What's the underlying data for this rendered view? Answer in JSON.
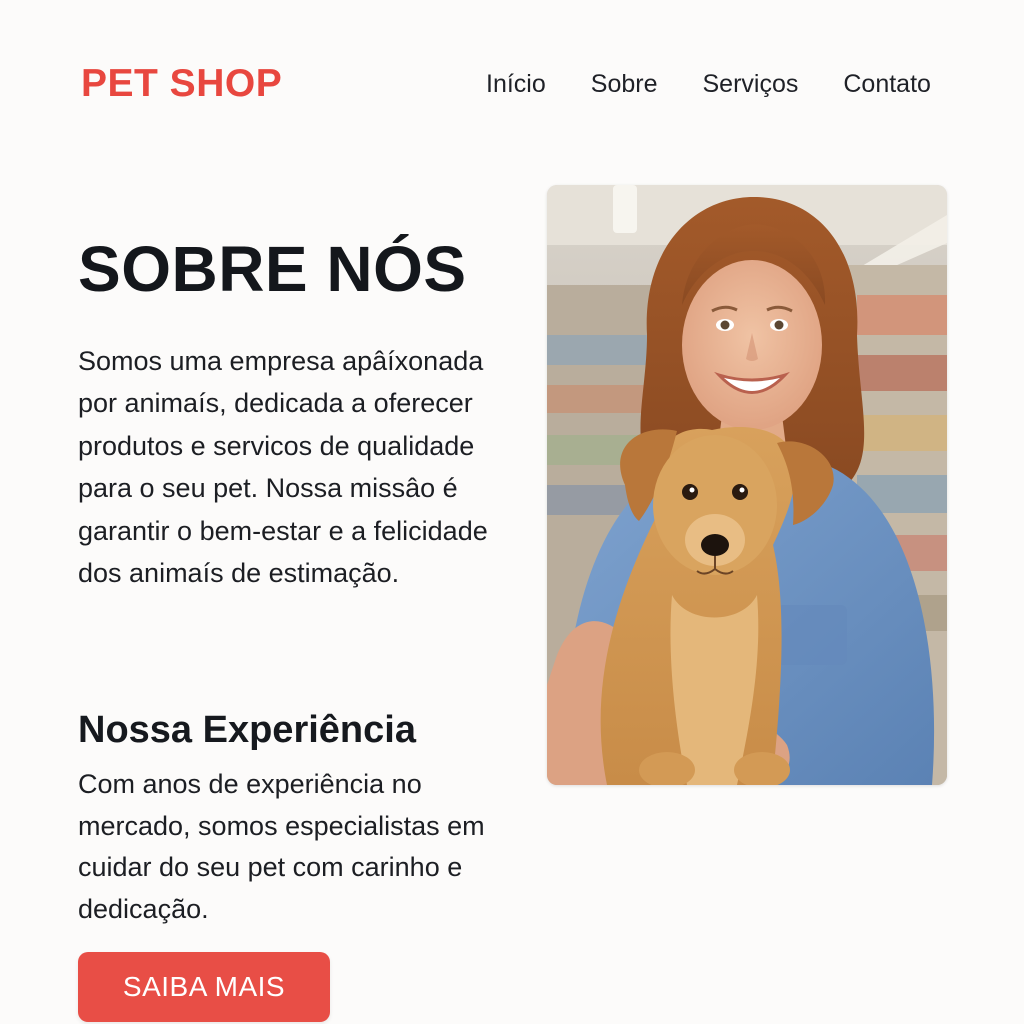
{
  "header": {
    "logo": "PET SHOP",
    "nav": [
      "Início",
      "Sobre",
      "Serviços",
      "Contato"
    ]
  },
  "about": {
    "title": "SOBRE NÓS",
    "intro": "Somos uma empresa apâíxonada por animaís, dedicada a oferecer produtos e servicos de qualidade para o seu pet. Nossa missâo é garantir o bem-estar e a felicidade dos animaís de estimação.",
    "subtitle": "Nossa Experiência",
    "experience": "Com anos de experiência no mercado, somos especialistas em cuidar do seu pet com carinho e dedicação.",
    "cta_label": "SAIBA MAIS"
  },
  "colors": {
    "brand": "#e8473f",
    "button": "#e84e46",
    "background": "#fcfbfa",
    "text": "#1b1d22"
  }
}
